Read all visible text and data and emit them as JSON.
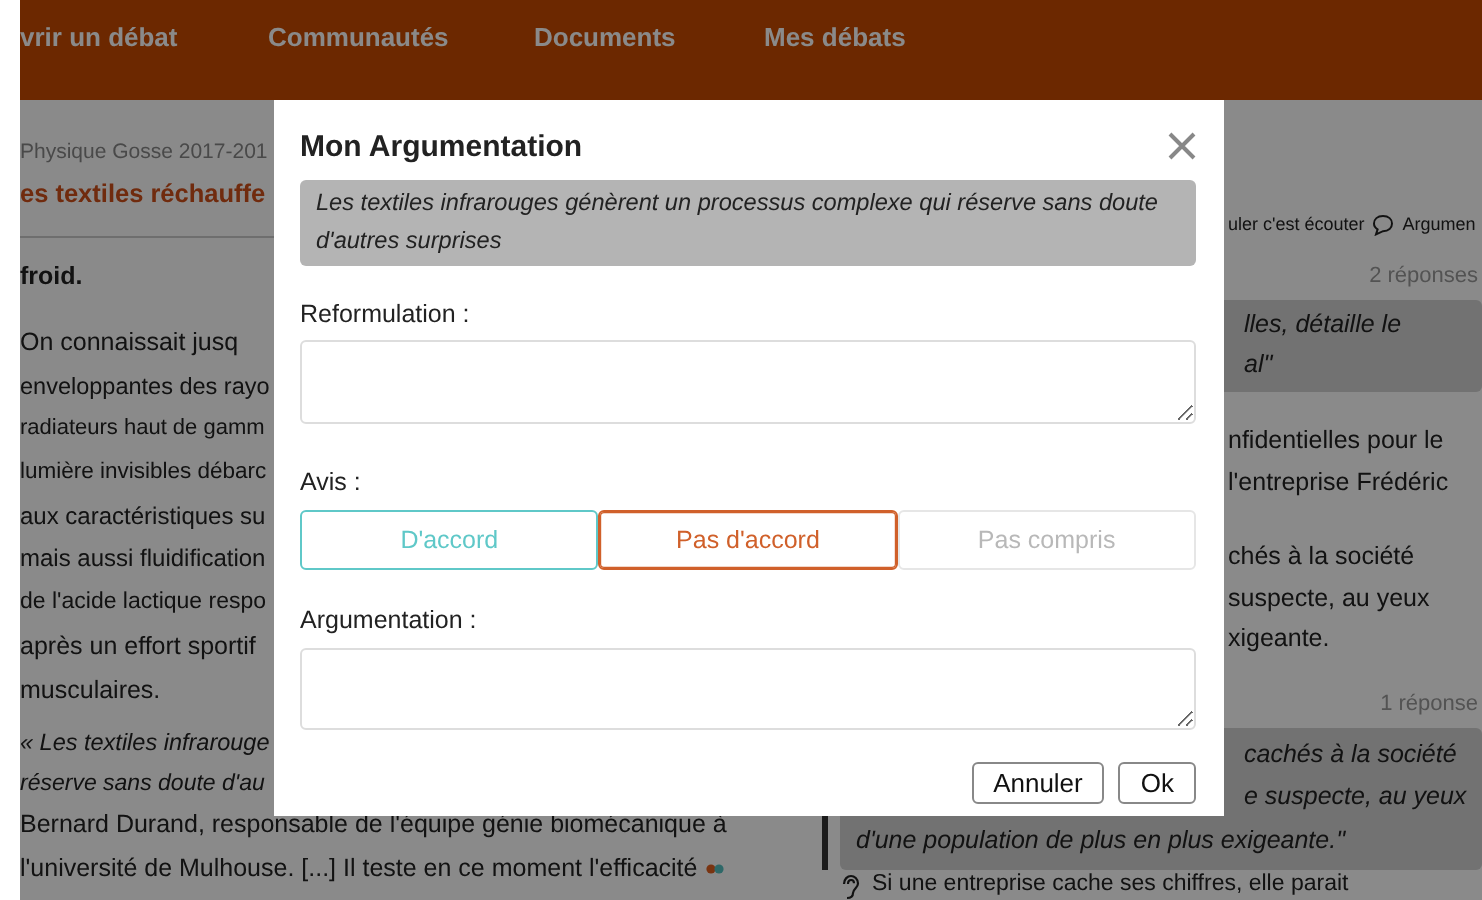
{
  "nav": {
    "items": [
      "vrir un débat",
      "Communautés",
      "Documents",
      "Mes débats"
    ]
  },
  "article": {
    "breadcrumb": "Physique Gosse 2017-201",
    "title": "es textiles réchauffe",
    "lead": "froid.",
    "paragraph_lines": [
      "On connaissait jusq",
      "enveloppantes des rayo",
      "radiateurs haut de gamm",
      "lumière invisibles débarc",
      "aux caractéristiques su",
      "mais aussi fluidification",
      "de l'acide lactique respo",
      "après un effort sportif",
      "musculaires."
    ],
    "quote_lines": [
      "« Les textiles infrarouge",
      "réserve sans doute d'au"
    ],
    "body_lines": [
      "Bernard Durand, responsable de l'équipe génie biomécanique à",
      "l'université de Mulhouse. [...] Il teste en ce moment l'efficacité"
    ]
  },
  "comments": {
    "toolbar": {
      "link": "uler c'est écouter",
      "action": "Argumen"
    },
    "threads": [
      {
        "count": "2 réponses",
        "quote": [
          {
            "text": "lles, détaille le",
            "kind": "cut"
          },
          {
            "text": "al\"",
            "kind": "cut"
          }
        ],
        "arguments": [
          {
            "kind": "plain",
            "lines": [
              {
                "text": "nfidentielles pour le",
                "kind": "cut"
              },
              {
                "text": "l'entreprise Frédéric",
                "kind": "cut"
              }
            ]
          },
          {
            "kind": "plain",
            "lines": [
              {
                "text": "chés à la société",
                "kind": "cut"
              },
              {
                "text": "suspecte, au yeux",
                "kind": "cut"
              },
              {
                "text": "xigeante.",
                "kind": "cut"
              }
            ]
          }
        ]
      },
      {
        "count": "1 réponse",
        "quote": [
          {
            "text": "cachés à la société",
            "kind": "cut"
          },
          {
            "text": "e suspecte, au yeux",
            "kind": "cut"
          },
          {
            "text": "d'une population de plus en plus exigeante.\"",
            "kind": "full"
          }
        ],
        "arguments": [
          {
            "kind": "listen",
            "lines": [
              {
                "text": "Si une entreprise cache ses chiffres, elle parait",
                "kind": "full"
              }
            ]
          }
        ]
      }
    ]
  },
  "modal": {
    "title": "Mon Argumentation",
    "quote": "Les textiles infrarouges génèrent un processus complexe qui réserve sans doute d'autres surprises",
    "reformulation_label": "Reformulation :",
    "avis_label": "Avis :",
    "avis_options": [
      {
        "label": "D'accord",
        "color": "#5fc8c8",
        "selected": false
      },
      {
        "label": "Pas d'accord",
        "color": "#d0602a",
        "selected": true
      },
      {
        "label": "Pas compris",
        "color": "#b8b8b8",
        "selected": false
      }
    ],
    "argumentation_label": "Argumentation :",
    "buttons": [
      "Annuler",
      "Ok"
    ]
  }
}
